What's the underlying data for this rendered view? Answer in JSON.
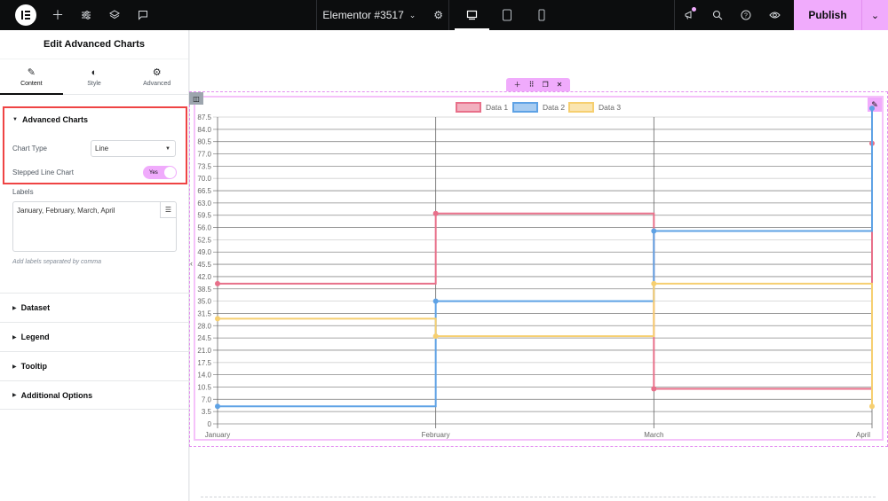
{
  "topbar": {
    "doc_title": "Elementor #3517",
    "publish_label": "Publish",
    "icons": [
      "elementor-logo",
      "add-icon",
      "settings-sliders-icon",
      "layers-icon",
      "comments-icon",
      "chevron-down-icon",
      "gear-icon",
      "desktop-icon",
      "tablet-icon",
      "mobile-icon",
      "megaphone-icon",
      "search-icon",
      "help-icon",
      "preview-eye-icon"
    ],
    "notification_dot_color": "#f0abfc"
  },
  "panel": {
    "title": "Edit Advanced Charts",
    "tabs": [
      {
        "label": "Content",
        "icon": "pencil-icon",
        "active": true
      },
      {
        "label": "Style",
        "icon": "half-circle-icon",
        "active": false
      },
      {
        "label": "Advanced",
        "icon": "gear-icon",
        "active": false
      }
    ],
    "section_title": "Advanced Charts",
    "chart_type_label": "Chart Type",
    "chart_type_value": "Line",
    "stepped_label": "Stepped Line Chart",
    "stepped_value": "Yes",
    "labels_label": "Labels",
    "labels_value": "January, February, March, April",
    "labels_hint": "Add labels separated by comma",
    "accordions": [
      "Dataset",
      "Legend",
      "Tooltip",
      "Additional Options"
    ]
  },
  "widget": {
    "toolbar_icons": [
      "add-icon",
      "drag-handle-icon",
      "duplicate-icon",
      "close-icon"
    ]
  },
  "chart_data": {
    "type": "line",
    "stepped": true,
    "categories": [
      "January",
      "February",
      "March",
      "April"
    ],
    "series": [
      {
        "name": "Data 1",
        "values": [
          40,
          60,
          10,
          80
        ],
        "color": "#e8708a"
      },
      {
        "name": "Data 2",
        "values": [
          5,
          35,
          55,
          90
        ],
        "color": "#5ea2e5"
      },
      {
        "name": "Data 3",
        "values": [
          30,
          25,
          40,
          5
        ],
        "color": "#f6cf70"
      }
    ],
    "yticks": [
      "0",
      "3.5",
      "7.0",
      "10.5",
      "14.0",
      "17.5",
      "21.0",
      "24.5",
      "28.0",
      "31.5",
      "35.0",
      "38.5",
      "42.0",
      "45.5",
      "49.0",
      "52.5",
      "56.0",
      "59.5",
      "63.0",
      "66.5",
      "70.0",
      "73.5",
      "77.0",
      "80.5",
      "84.0",
      "87.5"
    ],
    "ylim": [
      0,
      91
    ],
    "grid": true,
    "legend": "top-center",
    "title": "",
    "xlabel": "",
    "ylabel": ""
  }
}
